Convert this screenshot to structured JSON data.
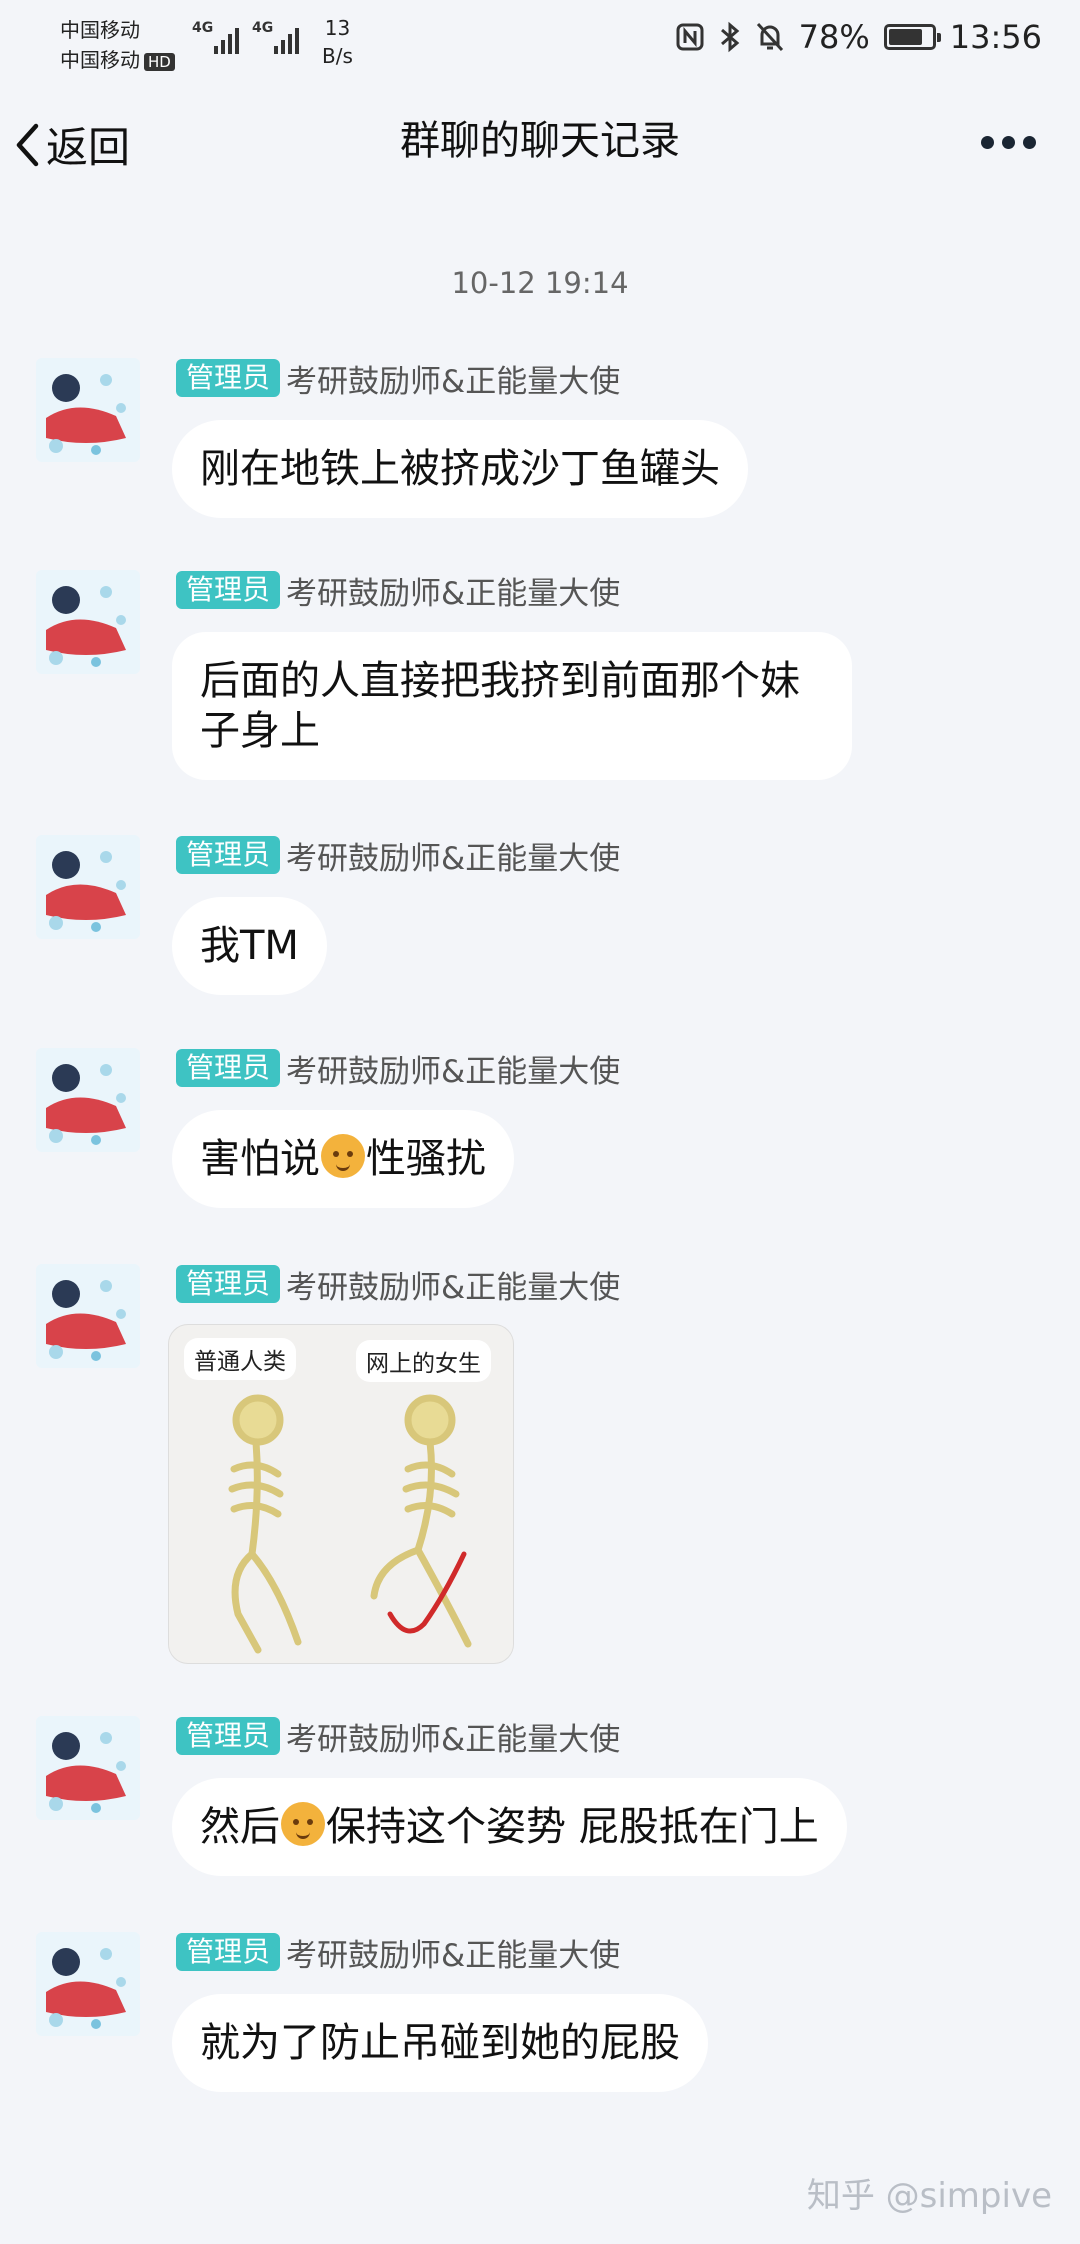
{
  "status_bar": {
    "carrier1": "中国移动",
    "carrier2": "中国移动",
    "hd": "HD",
    "net1": "4G",
    "net2": "4G",
    "speed_value": "13",
    "speed_unit": "B/s",
    "nfc_icon": "nfc-icon",
    "bluetooth_icon": "bluetooth-icon",
    "mute_icon": "bell-off-icon",
    "battery": "78%",
    "battery_level": 0.78,
    "time": "13:56"
  },
  "header": {
    "back_label": "返回",
    "title": "群聊的聊天记录",
    "more_icon": "more-dots-icon"
  },
  "timestamp": "10-12 19:14",
  "messages": [
    {
      "badge": "管理员",
      "sender": "考研鼓励师&正能量大使",
      "text": "刚在地铁上被挤成沙丁鱼罐头"
    },
    {
      "badge": "管理员",
      "sender": "考研鼓励师&正能量大使",
      "text": "后面的人直接把我挤到前面那个妹子身上"
    },
    {
      "badge": "管理员",
      "sender": "考研鼓励师&正能量大使",
      "text": "我TM"
    },
    {
      "badge": "管理员",
      "sender": "考研鼓励师&正能量大使",
      "text_before": "害怕说",
      "text_after": "性骚扰"
    },
    {
      "badge": "管理员",
      "sender": "考研鼓励师&正能量大使",
      "image_labels": [
        "普通人类",
        "网上的女生"
      ]
    },
    {
      "badge": "管理员",
      "sender": "考研鼓励师&正能量大使",
      "text_before": "然后",
      "text_after": "保持这个姿势 屁股抵在门上"
    },
    {
      "badge": "管理员",
      "sender": "考研鼓励师&正能量大使",
      "text": "就为了防止吊碰到她的屁股"
    }
  ],
  "watermark": "知乎 @simpive",
  "colors": {
    "background": "#f3f5f9",
    "badge": "#3ec3c3",
    "bubble": "#ffffff"
  }
}
